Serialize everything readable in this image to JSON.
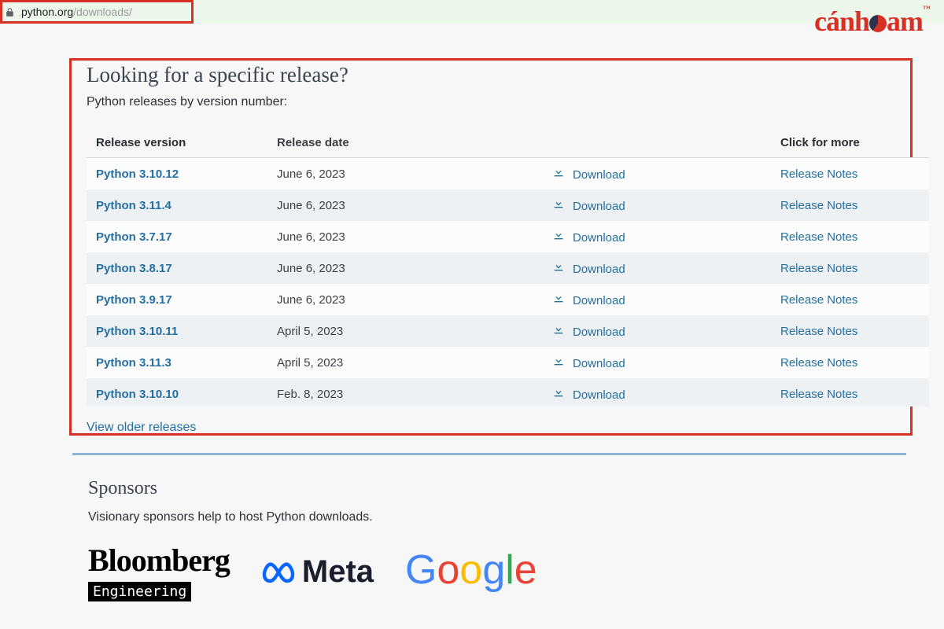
{
  "browser": {
    "domain": "python.org",
    "path": "/downloads/"
  },
  "watermark": {
    "text_a": "cánh",
    "text_b": "am",
    "tm": "™"
  },
  "releases_section": {
    "title": "Looking for a specific release?",
    "subtitle": "Python releases by version number:",
    "headers": {
      "version": "Release version",
      "date": "Release date",
      "download": "",
      "notes": "Click for more"
    },
    "download_label": "Download",
    "notes_label": "Release Notes",
    "older_link": "View older releases",
    "rows": [
      {
        "version": "Python 3.10.12",
        "date": "June 6, 2023"
      },
      {
        "version": "Python 3.11.4",
        "date": "June 6, 2023"
      },
      {
        "version": "Python 3.7.17",
        "date": "June 6, 2023"
      },
      {
        "version": "Python 3.8.17",
        "date": "June 6, 2023"
      },
      {
        "version": "Python 3.9.17",
        "date": "June 6, 2023"
      },
      {
        "version": "Python 3.10.11",
        "date": "April 5, 2023"
      },
      {
        "version": "Python 3.11.3",
        "date": "April 5, 2023"
      },
      {
        "version": "Python 3.10.10",
        "date": "Feb. 8, 2023"
      }
    ]
  },
  "sponsors": {
    "title": "Sponsors",
    "subtitle": "Visionary sponsors help to host Python downloads.",
    "bloomberg": "Bloomberg",
    "bloomberg_sub": "Engineering",
    "meta": "Meta",
    "google": {
      "g": "G",
      "o1": "o",
      "o2": "o",
      "g2": "g",
      "l": "l",
      "e": "e"
    }
  }
}
